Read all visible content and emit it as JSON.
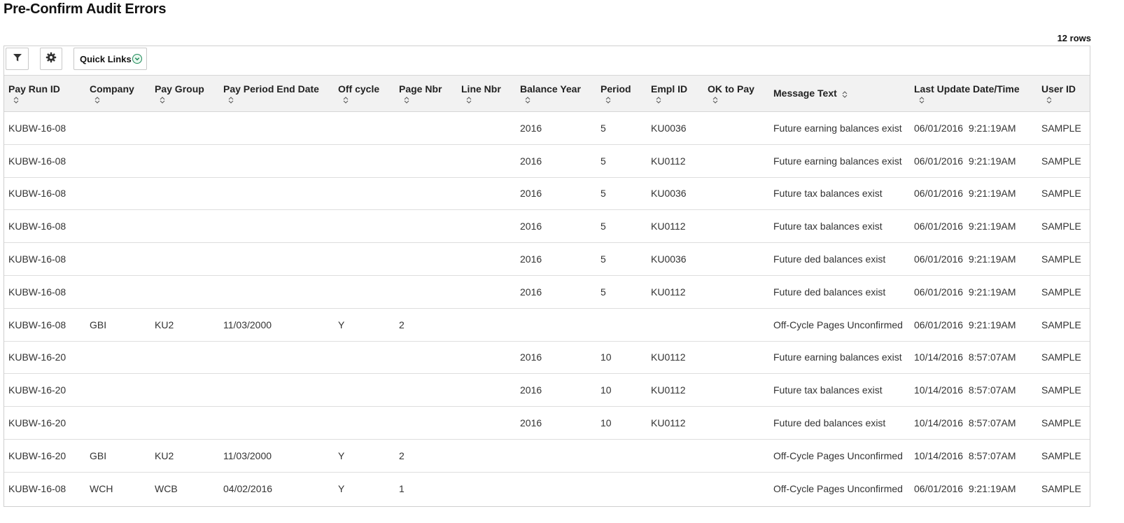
{
  "page": {
    "title": "Pre-Confirm Audit Errors",
    "row_count": "12 rows"
  },
  "toolbar": {
    "filter_icon": "filter-icon",
    "settings_icon": "gear-icon",
    "quick_links_label": "Quick Links",
    "quick_links_icon": "chevron-down-circle-icon"
  },
  "colors": {
    "header_bg": "#f2f2f2",
    "accent_green": "#1f8a5a"
  },
  "table": {
    "columns": [
      "Pay Run ID",
      "Company",
      "Pay Group",
      "Pay Period End Date",
      "Off cycle",
      "Page Nbr",
      "Line Nbr",
      "Balance Year",
      "Period",
      "Empl ID",
      "OK to Pay",
      "Message Text",
      "Last Update Date/Time",
      "User ID"
    ],
    "rows": [
      [
        "KUBW-16-08",
        "",
        "",
        "",
        "",
        "",
        "",
        "2016",
        "5",
        "KU0036",
        "",
        "Future earning balances exist",
        "06/01/2016  9:21:19AM",
        "SAMPLE"
      ],
      [
        "KUBW-16-08",
        "",
        "",
        "",
        "",
        "",
        "",
        "2016",
        "5",
        "KU0112",
        "",
        "Future earning balances exist",
        "06/01/2016  9:21:19AM",
        "SAMPLE"
      ],
      [
        "KUBW-16-08",
        "",
        "",
        "",
        "",
        "",
        "",
        "2016",
        "5",
        "KU0036",
        "",
        "Future tax balances exist",
        "06/01/2016  9:21:19AM",
        "SAMPLE"
      ],
      [
        "KUBW-16-08",
        "",
        "",
        "",
        "",
        "",
        "",
        "2016",
        "5",
        "KU0112",
        "",
        "Future tax balances exist",
        "06/01/2016  9:21:19AM",
        "SAMPLE"
      ],
      [
        "KUBW-16-08",
        "",
        "",
        "",
        "",
        "",
        "",
        "2016",
        "5",
        "KU0036",
        "",
        "Future ded balances exist",
        "06/01/2016  9:21:19AM",
        "SAMPLE"
      ],
      [
        "KUBW-16-08",
        "",
        "",
        "",
        "",
        "",
        "",
        "2016",
        "5",
        "KU0112",
        "",
        "Future ded balances exist",
        "06/01/2016  9:21:19AM",
        "SAMPLE"
      ],
      [
        "KUBW-16-08",
        "GBI",
        "KU2",
        "11/03/2000",
        "Y",
        "2",
        "",
        "",
        "",
        "",
        "",
        "Off-Cycle Pages Unconfirmed",
        "06/01/2016  9:21:19AM",
        "SAMPLE"
      ],
      [
        "KUBW-16-20",
        "",
        "",
        "",
        "",
        "",
        "",
        "2016",
        "10",
        "KU0112",
        "",
        "Future earning balances exist",
        "10/14/2016  8:57:07AM",
        "SAMPLE"
      ],
      [
        "KUBW-16-20",
        "",
        "",
        "",
        "",
        "",
        "",
        "2016",
        "10",
        "KU0112",
        "",
        "Future tax balances exist",
        "10/14/2016  8:57:07AM",
        "SAMPLE"
      ],
      [
        "KUBW-16-20",
        "",
        "",
        "",
        "",
        "",
        "",
        "2016",
        "10",
        "KU0112",
        "",
        "Future ded balances exist",
        "10/14/2016  8:57:07AM",
        "SAMPLE"
      ],
      [
        "KUBW-16-20",
        "GBI",
        "KU2",
        "11/03/2000",
        "Y",
        "2",
        "",
        "",
        "",
        "",
        "",
        "Off-Cycle Pages Unconfirmed",
        "10/14/2016  8:57:07AM",
        "SAMPLE"
      ],
      [
        "KUBW-16-08",
        "WCH",
        "WCB",
        "04/02/2016",
        "Y",
        "1",
        "",
        "",
        "",
        "",
        "",
        "Off-Cycle Pages Unconfirmed",
        "06/01/2016  9:21:19AM",
        "SAMPLE"
      ]
    ]
  }
}
